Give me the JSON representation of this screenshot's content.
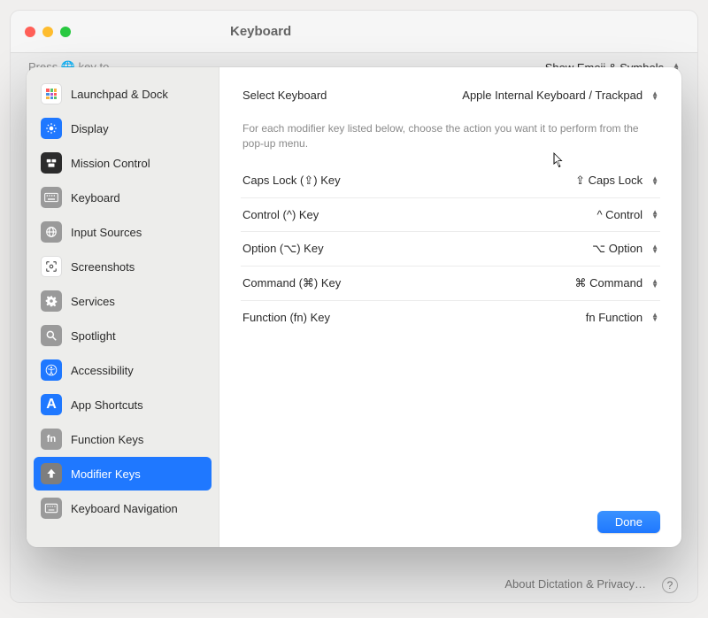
{
  "window": {
    "title": "Keyboard",
    "peek_left": "Press 🌐 key to",
    "peek_right": "Show Emoji & Symbols",
    "footer_link": "About Dictation & Privacy…"
  },
  "sidebar": {
    "items": [
      {
        "label": "Launchpad & Dock"
      },
      {
        "label": "Display"
      },
      {
        "label": "Mission Control"
      },
      {
        "label": "Keyboard"
      },
      {
        "label": "Input Sources"
      },
      {
        "label": "Screenshots"
      },
      {
        "label": "Services"
      },
      {
        "label": "Spotlight"
      },
      {
        "label": "Accessibility"
      },
      {
        "label": "App Shortcuts"
      },
      {
        "label": "Function Keys"
      },
      {
        "label": "Modifier Keys"
      },
      {
        "label": "Keyboard Navigation"
      }
    ],
    "selected_index": 11
  },
  "main": {
    "select_keyboard_label": "Select Keyboard",
    "select_keyboard_value": "Apple Internal Keyboard / Trackpad",
    "description": "For each modifier key listed below, choose the action you want it to perform from the pop-up menu.",
    "rows": [
      {
        "label": "Caps Lock (⇪) Key",
        "value": "⇪ Caps Lock"
      },
      {
        "label": "Control (^) Key",
        "value": "^ Control"
      },
      {
        "label": "Option (⌥) Key",
        "value": "⌥ Option"
      },
      {
        "label": "Command (⌘) Key",
        "value": "⌘ Command"
      },
      {
        "label": "Function (fn) Key",
        "value": "fn Function"
      }
    ],
    "done_label": "Done"
  }
}
